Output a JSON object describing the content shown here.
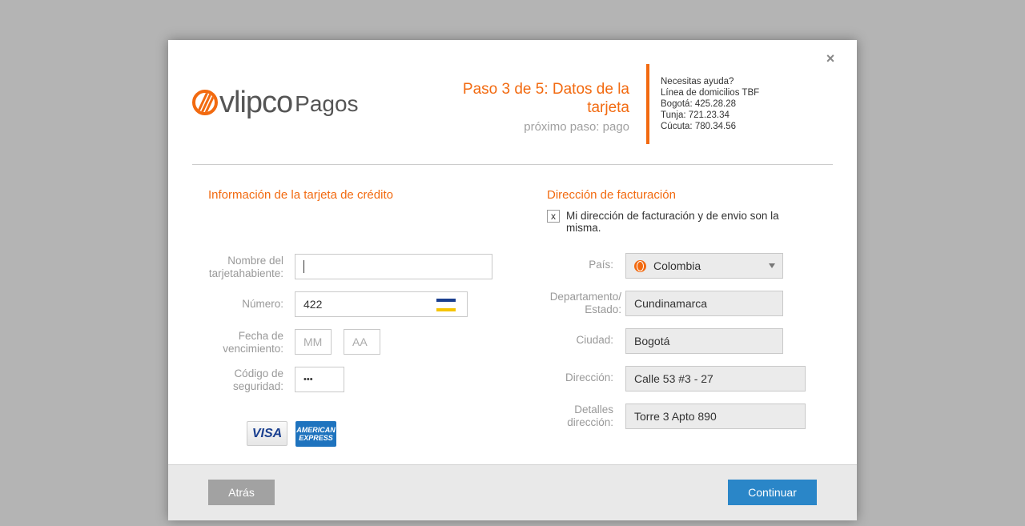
{
  "brand": {
    "wordmark": "vlipco",
    "product": "Pagos"
  },
  "header": {
    "step_title": "Paso 3 de 5: Datos de la tarjeta",
    "next_step": "próximo paso: pago",
    "help": [
      "Necesitas ayuda?",
      "Línea de domicilios TBF",
      "Bogotá: 425.28.28",
      "Tunja: 721.23.34",
      "Cúcuta: 780.34.56"
    ]
  },
  "card": {
    "title": "Información de la tarjeta de crédito",
    "holder_label": "Nombre del tarjetahabiente:",
    "holder_value": "",
    "number_label": "Número:",
    "number_value": "422",
    "expiry_label": "Fecha de vencimiento:",
    "month_placeholder": "MM",
    "year_placeholder": "AA",
    "cvv_label": "Código de seguridad:",
    "cvv_value": "•••",
    "visa_label": "VISA",
    "amex_line1": "AMERICAN",
    "amex_line2": "EXPRESS"
  },
  "billing": {
    "title": "Dirección de facturación",
    "same_checkbox_mark": "x",
    "same_checkbox_label": "Mi dirección de facturación y de envio son la misma.",
    "country_label": "País:",
    "country_value": "Colombia",
    "state_label": "Departamento/ Estado:",
    "state_value": "Cundinamarca",
    "city_label": "Ciudad:",
    "city_value": "Bogotá",
    "address_label": "Dirección:",
    "address_value": "Calle 53 #3 - 27",
    "details_label": "Detalles dirección:",
    "details_value": "Torre 3 Apto 890"
  },
  "footer": {
    "back_label": "Atrás",
    "continue_label": "Continuar"
  },
  "colors": {
    "accent": "#f26a10",
    "primary_button": "#2a86c8",
    "secondary_button": "#a2a2a2"
  },
  "icons": {
    "close": "close-icon",
    "card_type": "credit-card-icon",
    "country": "globe-icon",
    "dropdown": "chevron-down-icon"
  }
}
